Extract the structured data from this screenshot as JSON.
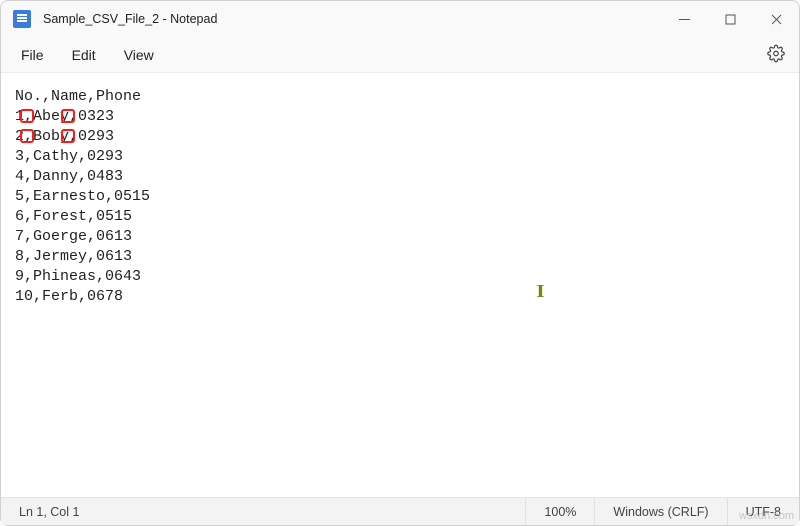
{
  "titlebar": {
    "title": "Sample_CSV_File_2 - Notepad"
  },
  "menubar": {
    "file": "File",
    "edit": "Edit",
    "view": "View"
  },
  "content": {
    "lines": [
      "No.,Name,Phone",
      "1,Abey,0323",
      "2,Boby,0293",
      "3,Cathy,0293",
      "4,Danny,0483",
      "5,Earnesto,0515",
      "6,Forest,0515",
      "7,Goerge,0613",
      "8,Jermey,0613",
      "9,Phineas,0643",
      "10,Ferb,0678"
    ]
  },
  "statusbar": {
    "position": "Ln 1, Col 1",
    "zoom": "100%",
    "eol": "Windows (CRLF)",
    "encoding": "UTF-8"
  },
  "watermark": "wsxdn.com"
}
